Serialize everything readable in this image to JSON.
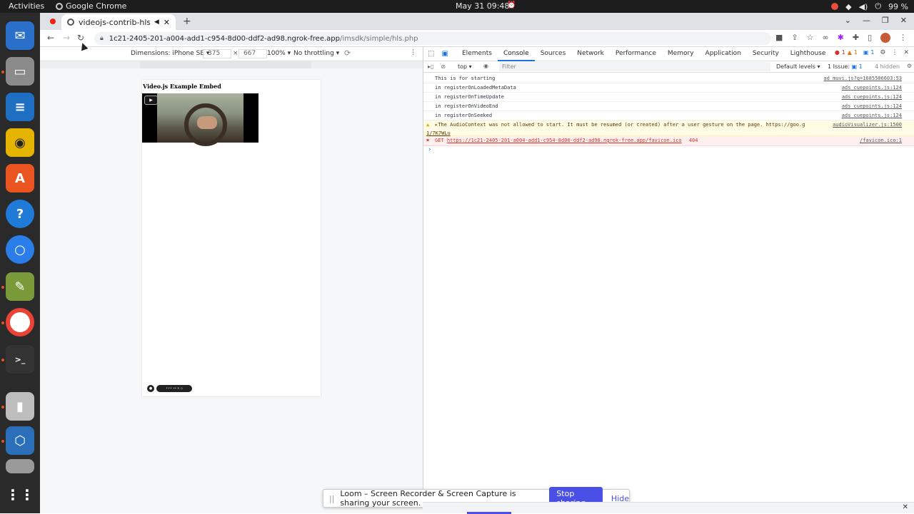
{
  "topbar": {
    "activities": "Activities",
    "app_name": "Google Chrome",
    "clock": "May 31  09:48",
    "battery": "99 %"
  },
  "dock": {
    "items": [
      "thunderbird",
      "files",
      "writer",
      "rhythmbox",
      "software",
      "help",
      "chromium",
      "gimp",
      "chrome",
      "terminal",
      "usb-drive",
      "virtualbox",
      "disk",
      "apps-grid"
    ]
  },
  "browser": {
    "tab_title": "videojs-contrib-hls em",
    "url_host": "1c21-2405-201-a004-add1-c954-8d00-ddf2-ad98.ngrok-free.app",
    "url_path": "/imsdk/simple/hls.php"
  },
  "device_toolbar": {
    "dimensions": "Dimensions: iPhone SE ▾",
    "width": "375",
    "times": "×",
    "height": "667",
    "zoom": "100% ▾",
    "throttling": "No throttling ▾"
  },
  "page": {
    "heading": "Video.js Example Embed"
  },
  "devtools": {
    "tabs": [
      "Elements",
      "Console",
      "Sources",
      "Network",
      "Performance",
      "Memory",
      "Application",
      "Security",
      "Lighthouse"
    ],
    "active_tab": "Console",
    "overflow": "»",
    "err_count": "1",
    "warn_count": "1",
    "info_count": "1",
    "context": "top ▾",
    "filter_placeholder": "Filter",
    "levels": "Default levels ▾",
    "issue": "1 Issue: ",
    "issue_count": "1",
    "hidden": "4 hidden"
  },
  "console": {
    "logs": [
      {
        "text": "This is for starting",
        "src": "ad_muvi.js?q=1685506603:53"
      },
      {
        "text": "in registerOnLoadedMetaData",
        "src": "ads_cuepoints.js:124"
      },
      {
        "text": "in registerOnTimeUpdate",
        "src": "ads_cuepoints.js:124"
      },
      {
        "text": "in registerOnVideoEnd",
        "src": "ads_cuepoints.js:124"
      },
      {
        "text": "in registerOnSeeked",
        "src": "ads_cuepoints.js:124"
      }
    ],
    "warning": {
      "text": "▸The AudioContext was not allowed to start. It must be resumed (or created) after a user gesture on the page. https://goo.g",
      "text2": "1/7K7WLu",
      "src": "audioVisualizer.js:1500"
    },
    "error": {
      "method": "GET",
      "url": "https://1c21-2405-201-a004-add1-c954-8d00-ddf2-ad98.ngrok-free.app/favicon.ico",
      "code": "404",
      "src": "/favicon.ico:1"
    },
    "prompt": "›"
  },
  "loom": {
    "message": "Loom – Screen Recorder & Screen Capture is sharing your screen.",
    "stop": "Stop sharing",
    "hide": "Hide"
  }
}
